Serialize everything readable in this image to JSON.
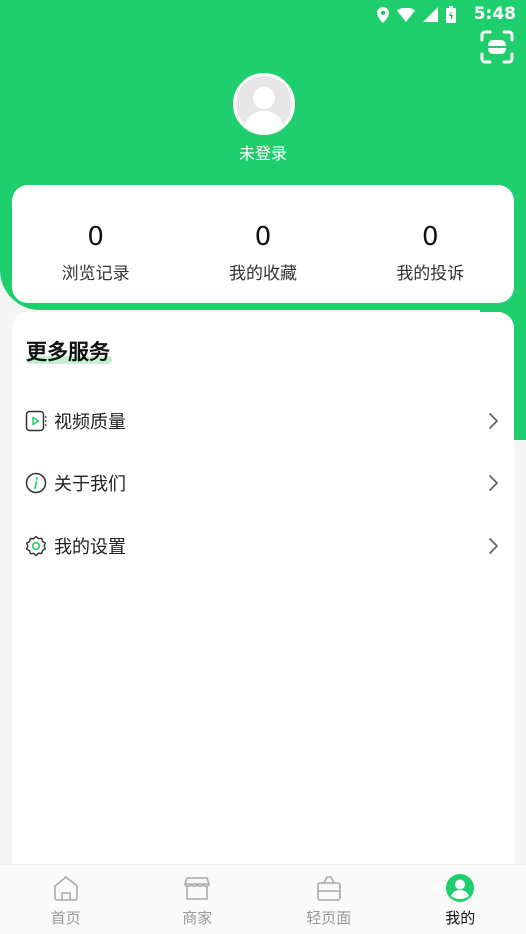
{
  "status_bar": {
    "time": "5:48"
  },
  "profile": {
    "login_label": "未登录"
  },
  "stats": [
    {
      "count": "0",
      "label": "浏览记录"
    },
    {
      "count": "0",
      "label": "我的收藏"
    },
    {
      "count": "0",
      "label": "我的投诉"
    }
  ],
  "services": {
    "title": "更多服务",
    "items": [
      {
        "label": "视频质量",
        "icon": "video-quality-icon"
      },
      {
        "label": "关于我们",
        "icon": "info-icon"
      },
      {
        "label": "我的设置",
        "icon": "settings-icon"
      }
    ]
  },
  "tabbar": [
    {
      "label": "首页",
      "icon": "home-icon"
    },
    {
      "label": "商家",
      "icon": "store-icon"
    },
    {
      "label": "轻页面",
      "icon": "bag-icon"
    },
    {
      "label": "我的",
      "icon": "profile-icon",
      "active": true
    }
  ],
  "colors": {
    "accent": "#1fce6c"
  }
}
